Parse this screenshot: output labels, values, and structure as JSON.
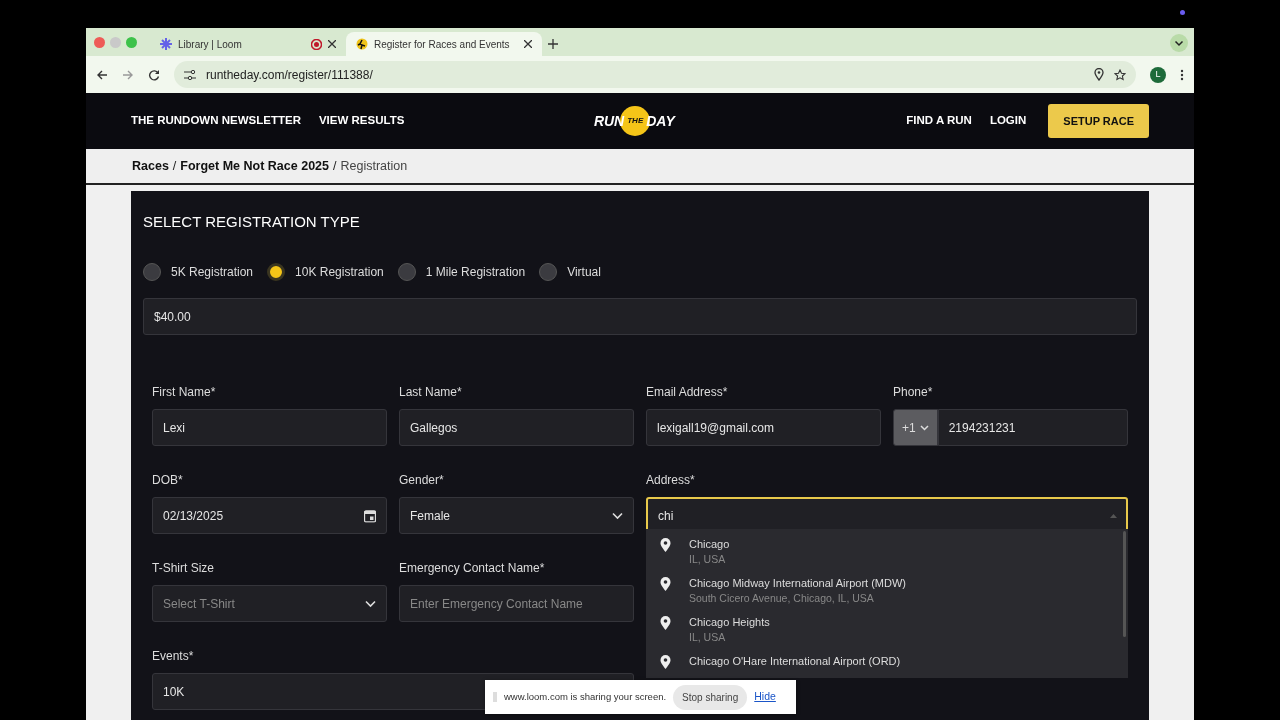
{
  "browser": {
    "tabs": [
      {
        "title": "Library | Loom",
        "selected": false,
        "recording": true
      },
      {
        "title": "Register for Races and Events",
        "selected": true,
        "recording": false
      }
    ],
    "url": "runtheday.com/register/111388/",
    "profile_initial": "L"
  },
  "navbar": {
    "left_links": [
      "THE RUNDOWN NEWSLETTER",
      "VIEW RESULTS"
    ],
    "logo": [
      "RUN",
      "THE",
      "DAY"
    ],
    "right_links": [
      "FIND A RUN",
      "LOGIN"
    ],
    "cta": "SETUP RACE"
  },
  "breadcrumb_separator": "/",
  "breadcrumb": [
    {
      "label": "Races",
      "current": false
    },
    {
      "label": "Forget Me Not Race 2025",
      "current": false
    },
    {
      "label": "Registration",
      "current": true
    }
  ],
  "section_title": "SELECT REGISTRATION TYPE",
  "registration_types": [
    {
      "label": "5K Registration",
      "selected": false
    },
    {
      "label": "10K Registration",
      "selected": true
    },
    {
      "label": "1 Mile Registration",
      "selected": false
    },
    {
      "label": "Virtual",
      "selected": false
    }
  ],
  "price": "$40.00",
  "fields": [
    {
      "label": "First Name*",
      "kind": "text",
      "value": "Lexi"
    },
    {
      "label": "Last Name*",
      "kind": "text",
      "value": "Gallegos"
    },
    {
      "label": "Email Address*",
      "kind": "text",
      "value": "lexigall19@gmail.com"
    },
    {
      "label": "Phone*",
      "kind": "phone",
      "country_code": "+1",
      "value": "2194231231"
    },
    {
      "label": "DOB*",
      "kind": "date",
      "value": "02/13/2025"
    },
    {
      "label": "Gender*",
      "kind": "select",
      "value": "Female"
    },
    {
      "label": "Address*",
      "kind": "autocomplete",
      "value": "chi",
      "focused": true
    },
    {
      "label": "T-Shirt Size",
      "kind": "select",
      "placeholder": "Select T-Shirt"
    },
    {
      "label": "Emergency Contact Name*",
      "kind": "text",
      "placeholder": "Enter Emergency Contact Name"
    },
    {
      "label": "Events*",
      "kind": "text",
      "value": "10K"
    }
  ],
  "address_suggestions": [
    {
      "title": "Chicago",
      "subtitle": "IL, USA"
    },
    {
      "title": "Chicago Midway International Airport (MDW)",
      "subtitle": "South Cicero Avenue, Chicago, IL, USA"
    },
    {
      "title": "Chicago Heights",
      "subtitle": "IL, USA"
    },
    {
      "title": "Chicago O'Hare International Airport (ORD)"
    }
  ],
  "share_bar": {
    "message": "www.loom.com is sharing your screen.",
    "stop": "Stop sharing",
    "hide": "Hide"
  }
}
